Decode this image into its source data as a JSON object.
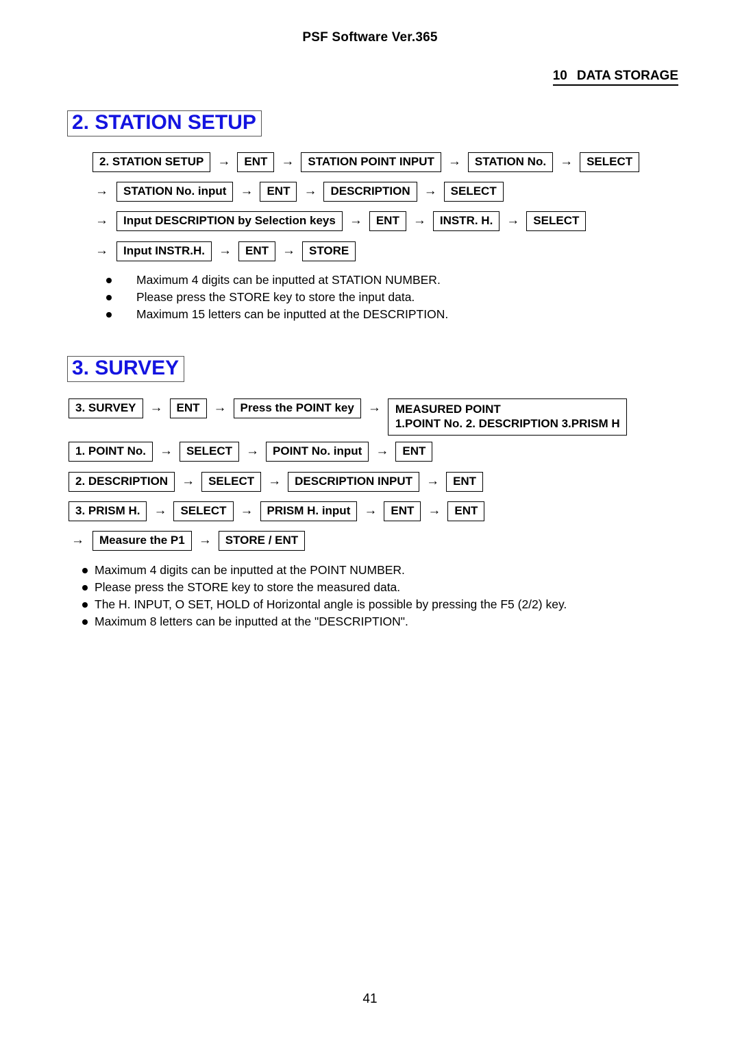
{
  "header": {
    "software": "PSF Software Ver.365",
    "chapter_number": "10",
    "chapter_title": "DATA STORAGE"
  },
  "arrow_glyph": "→",
  "sections": [
    {
      "title": "2. STATION SETUP",
      "flow": [
        {
          "lead_arrow": "",
          "items": [
            "2. STATION SETUP",
            "ENT",
            "STATION POINT INPUT",
            "STATION No.",
            "SELECT"
          ]
        },
        {
          "lead_arrow": "→",
          "items": [
            "STATION No. input",
            "ENT",
            "DESCRIPTION",
            "SELECT"
          ]
        },
        {
          "lead_arrow": "→",
          "items": [
            "Input DESCRIPTION by Selection keys",
            "ENT",
            "INSTR. H.",
            "SELECT"
          ]
        },
        {
          "lead_arrow": "→",
          "items": [
            "Input INSTR.H.",
            "ENT",
            "STORE"
          ]
        }
      ],
      "notes": [
        "Maximum 4 digits can be inputted at STATION NUMBER.",
        "Please press the STORE key to store the input data.",
        "Maximum 15 letters can be inputted at the DESCRIPTION."
      ]
    },
    {
      "title": "3. SURVEY",
      "flow": [
        {
          "lead_arrow": "",
          "items": [
            "3. SURVEY",
            "ENT",
            "Press the POINT key"
          ],
          "trailing_arrow": "→",
          "multiline_box": {
            "line1": "MEASURED POINT",
            "line2": "1.POINT No. 2. DESCRIPTION 3.PRISM H"
          }
        },
        {
          "lead_arrow": "",
          "items": [
            "1. POINT No.",
            "SELECT",
            "POINT No. input",
            "ENT"
          ]
        },
        {
          "lead_arrow": "",
          "items": [
            "2. DESCRIPTION",
            "SELECT",
            "DESCRIPTION INPUT",
            "ENT"
          ]
        },
        {
          "lead_arrow": "",
          "items": [
            "3. PRISM H.",
            "SELECT",
            "PRISM H. input",
            "ENT",
            "ENT"
          ]
        },
        {
          "lead_arrow": "→",
          "items": [
            "Measure the P1",
            "STORE / ENT"
          ]
        }
      ],
      "notes": [
        "Maximum 4 digits can be inputted at the POINT NUMBER.",
        "Please press the STORE key to store the measured data.",
        "The H. INPUT, O SET, HOLD of Horizontal angle is possible by pressing the F5 (2/2) key.",
        "Maximum 8 letters can be inputted at the \"DESCRIPTION\"."
      ]
    }
  ],
  "footer": {
    "page_number": "41"
  },
  "colors": {
    "title_blue": "#1414e0",
    "text_black": "#000000",
    "background": "#ffffff"
  }
}
